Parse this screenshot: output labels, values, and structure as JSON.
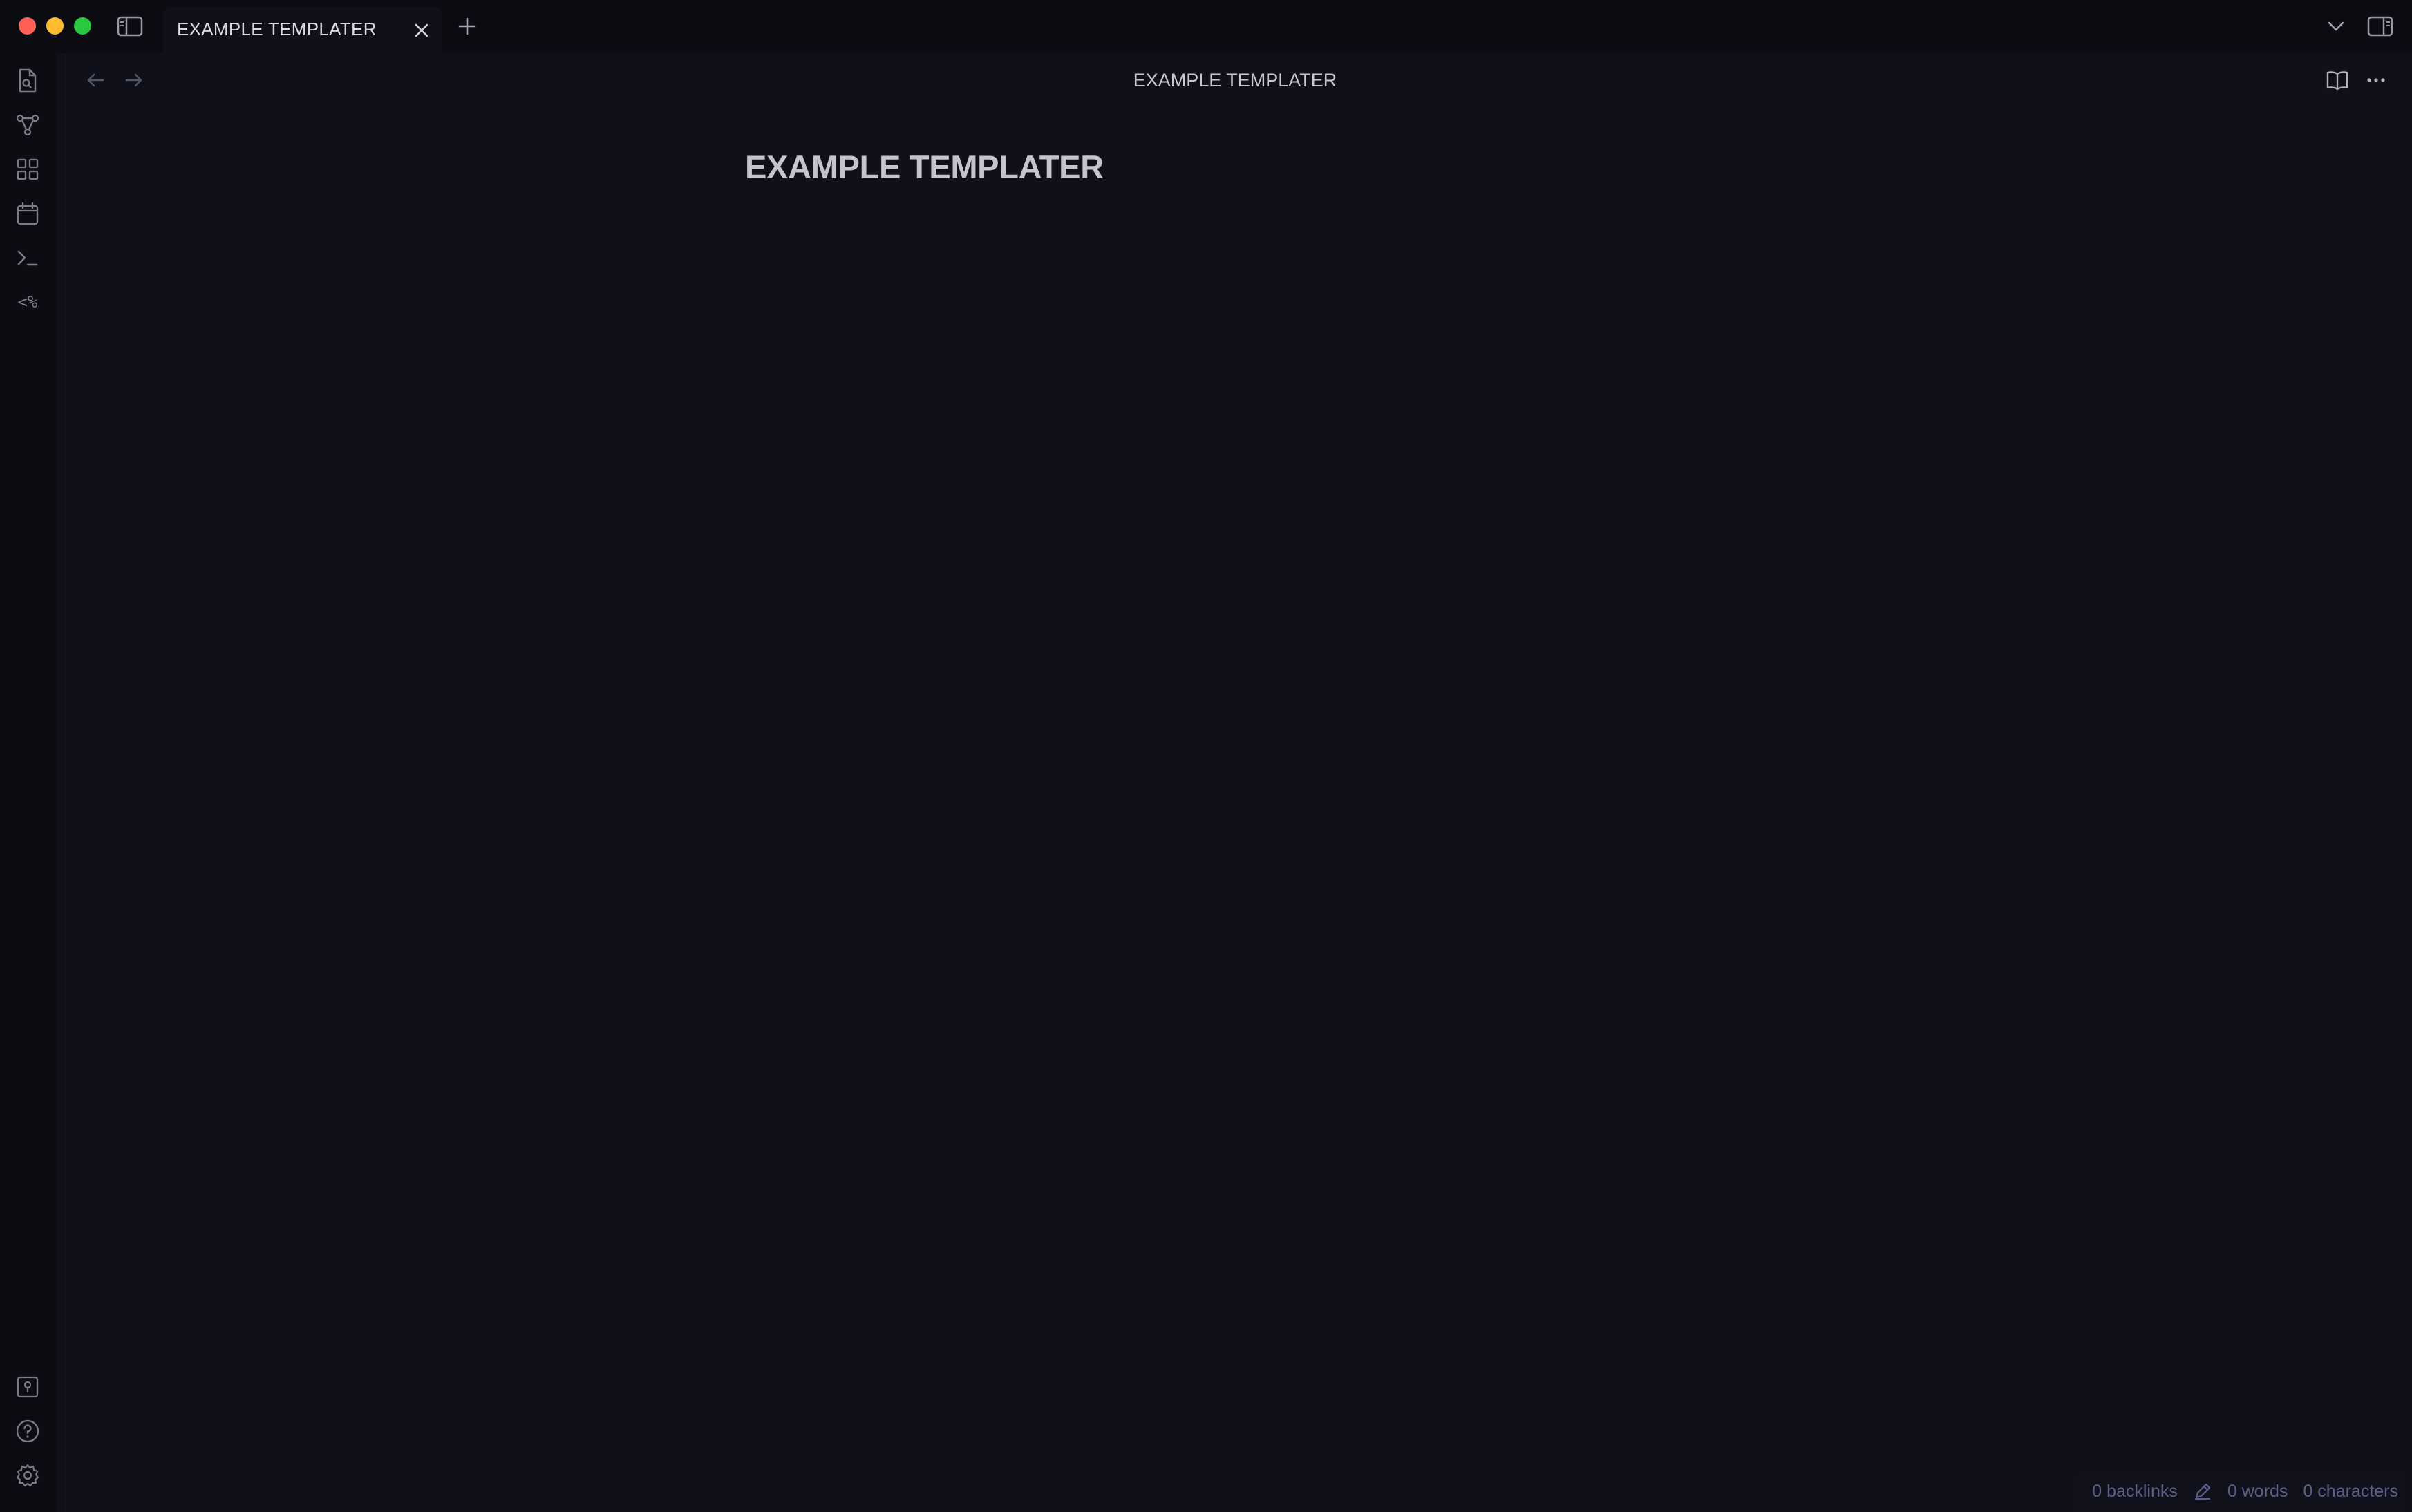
{
  "titlebar": {
    "tab_label": "EXAMPLE TEMPLATER",
    "icons": [
      "sidebar-toggle-icon",
      "close-icon",
      "plus-icon",
      "chevron-down-icon",
      "right-sidebar-toggle-icon"
    ]
  },
  "ribbon": {
    "items": [
      {
        "icon": "file-search-icon"
      },
      {
        "icon": "graph-icon"
      },
      {
        "icon": "grid-icon"
      },
      {
        "icon": "calendar-icon"
      },
      {
        "icon": "terminal-icon"
      },
      {
        "icon": "templater-icon",
        "text": "<%"
      }
    ],
    "bottom_items": [
      {
        "icon": "vault-icon"
      },
      {
        "icon": "help-icon"
      },
      {
        "icon": "settings-icon"
      }
    ]
  },
  "editor": {
    "view_title": "EXAMPLE TEMPLATER",
    "note_title": "EXAMPLE TEMPLATER"
  },
  "statusbar": {
    "backlinks": "0 backlinks",
    "words": "0 words",
    "characters": "0 characters"
  },
  "colors": {
    "background": "#10101a",
    "titlebar": "#0b0b12",
    "status_text": "#5c5f8a",
    "close": "#fe5f57",
    "minimize": "#febc2e",
    "maximize": "#28c840"
  }
}
